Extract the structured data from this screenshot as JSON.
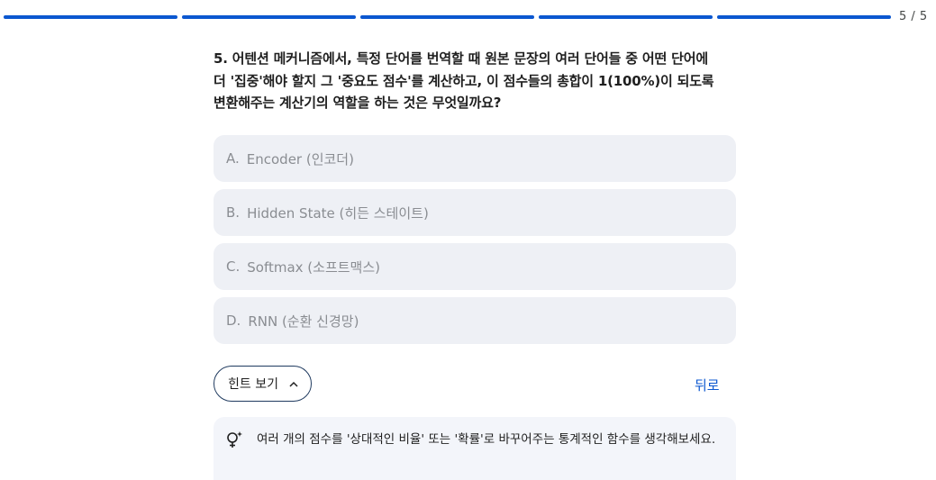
{
  "progress": {
    "segments": 5,
    "completed": 5,
    "counter": "5 / 5",
    "accent": "#0b57d0"
  },
  "question": {
    "lines": [
      "5. 어텐션 메커니즘에서, 특정 단어를 번역할 때 원본 문장의 여러 단어들 중 어떤 단어에",
      "더 '집중'해야 할지 그 '중요도 점수'를 계산하고, 이 점수들의 총합이 1(100%)이 되도록",
      "변환해주는 계산기의 역할을 하는 것은 무엇일까요?"
    ]
  },
  "options": [
    {
      "letter": "A.",
      "text": "Encoder (인코더)"
    },
    {
      "letter": "B.",
      "text": "Hidden State (히든 스테이트)"
    },
    {
      "letter": "C.",
      "text": "Softmax (소프트맥스)"
    },
    {
      "letter": "D.",
      "text": "RNN (순환 신경망)"
    }
  ],
  "hint_button": {
    "label": "힌트 보기",
    "icon": "chevron-up-icon"
  },
  "back_button": {
    "label": "뒤로"
  },
  "hint": {
    "icon": "lightbulb-sparkle-icon",
    "text": "여러 개의 점수를 '상대적인 비율' 또는 '확률'로 바꾸어주는 통계적인 함수를 생각해보세요."
  }
}
